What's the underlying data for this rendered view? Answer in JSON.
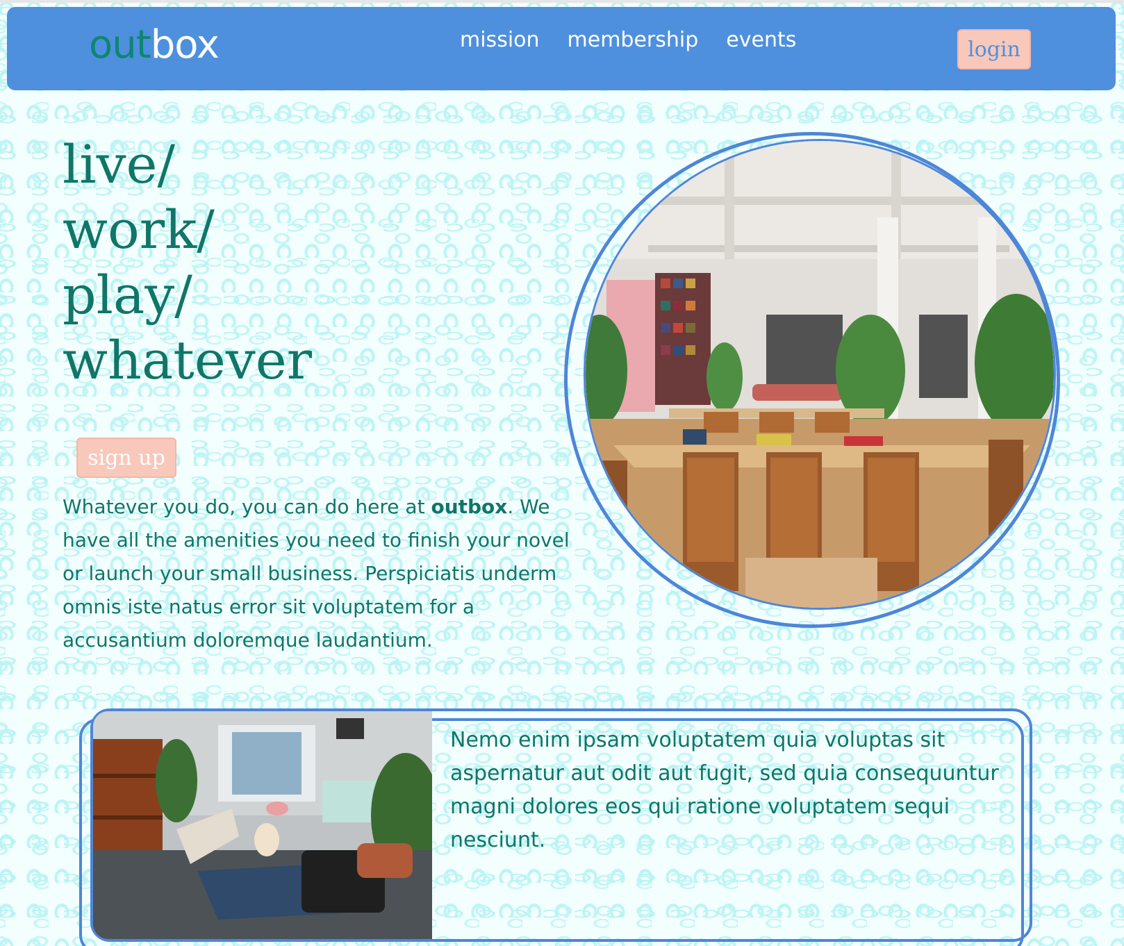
{
  "brand": {
    "part1": "out",
    "part2": "box"
  },
  "nav": {
    "items": [
      {
        "label": "mission"
      },
      {
        "label": "membership"
      },
      {
        "label": "events"
      }
    ]
  },
  "header": {
    "login_label": "login"
  },
  "hero": {
    "lines": [
      "live/",
      "work/",
      "play/",
      "whatever"
    ],
    "signup_label": "sign up",
    "intro_before": "Whatever you do, you can do here at ",
    "intro_brand": "outbox",
    "intro_after": ". We have all the amenities you need to finish your novel or launch your small business. Perspiciatis underm omnis iste natus error sit voluptatem for a accusantium doloremque laudantium."
  },
  "feature": {
    "text": "Nemo enim ipsam voluptatem quia voluptas sit aspernatur aut odit aut fugit, sed quia consequuntur magni dolores eos qui ratione voluptatem sequi nesciunt."
  },
  "colors": {
    "accent": "#4e90de",
    "brand_green": "#0f7668",
    "button_pink": "#f8c8bb",
    "pattern": "#b9f3f3"
  },
  "icons": {
    "hero_photo": "coworking-space-photo",
    "feature_photo": "lounge-photo"
  }
}
